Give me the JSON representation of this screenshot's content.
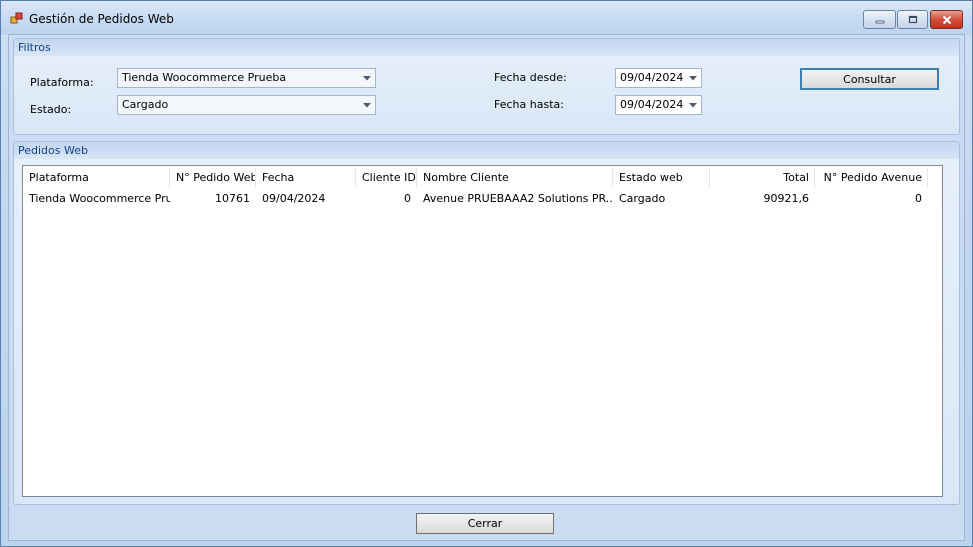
{
  "window": {
    "title": "Gestión de Pedidos Web"
  },
  "filters": {
    "group_title": "Filtros",
    "plataforma_label": "Plataforma:",
    "plataforma_value": "Tienda Woocommerce Prueba",
    "estado_label": "Estado:",
    "estado_value": "Cargado",
    "fecha_desde_label": "Fecha desde:",
    "fecha_desde_value": "09/04/2024",
    "fecha_hasta_label": "Fecha hasta:",
    "fecha_hasta_value": "09/04/2024",
    "consultar_label": "Consultar"
  },
  "orders": {
    "group_title": "Pedidos Web",
    "columns": [
      "Plataforma",
      "N° Pedido Web",
      "Fecha",
      "Cliente ID",
      "Nombre Cliente",
      "Estado web",
      "Total",
      "N° Pedido Avenue"
    ],
    "rows": [
      [
        "Tienda Woocommerce Pru...",
        "10761",
        "09/04/2024",
        "0",
        "Avenue PRUEBAAA2 Solutions PR...",
        "Cargado",
        "90921,6",
        "0"
      ]
    ]
  },
  "footer": {
    "cerrar_label": "Cerrar"
  },
  "icons": {
    "app": "app-window-icon",
    "dropdown": "chevron-down-icon",
    "minimize": "minimize-icon",
    "maximize": "maximize-icon",
    "close": "close-icon"
  }
}
